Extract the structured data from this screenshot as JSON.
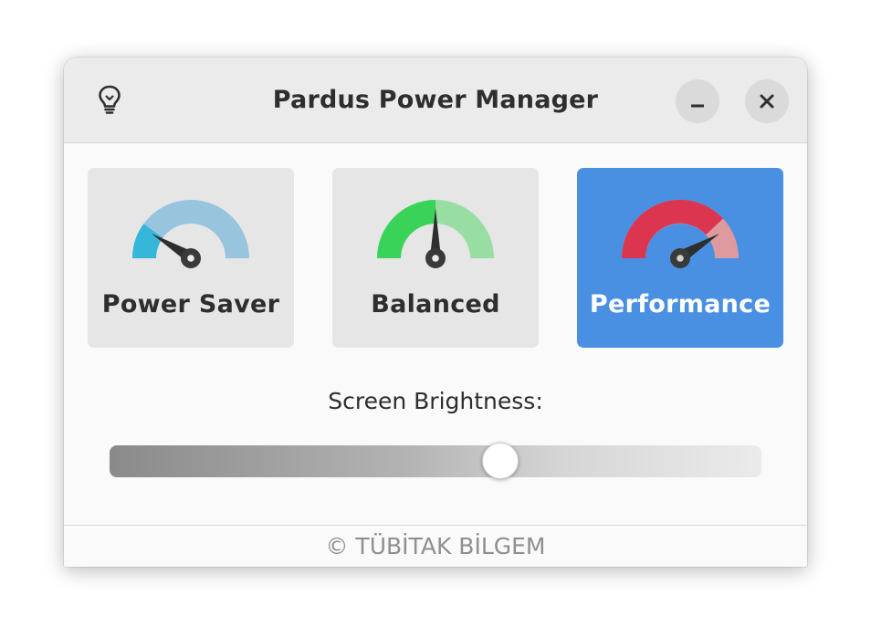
{
  "window": {
    "title": "Pardus Power Manager",
    "app_icon": "lightbulb-icon",
    "minimize_icon": "minimize-icon",
    "close_icon": "close-icon"
  },
  "modes": [
    {
      "label": "Power Saver",
      "icon": "speedometer-low-icon",
      "selected": false
    },
    {
      "label": "Balanced",
      "icon": "speedometer-medium-icon",
      "selected": false
    },
    {
      "label": "Performance",
      "icon": "speedometer-high-icon",
      "selected": true
    }
  ],
  "brightness": {
    "label": "Screen Brightness:",
    "value_fraction": 0.6
  },
  "footer": {
    "text": "© TÜBİTAK BİLGEM"
  },
  "colors": {
    "accent": "#4a90e2",
    "saver_gauge": "#36b6d8",
    "balanced_gauge": "#3ad35a",
    "performance_gauge": "#dc3550"
  }
}
